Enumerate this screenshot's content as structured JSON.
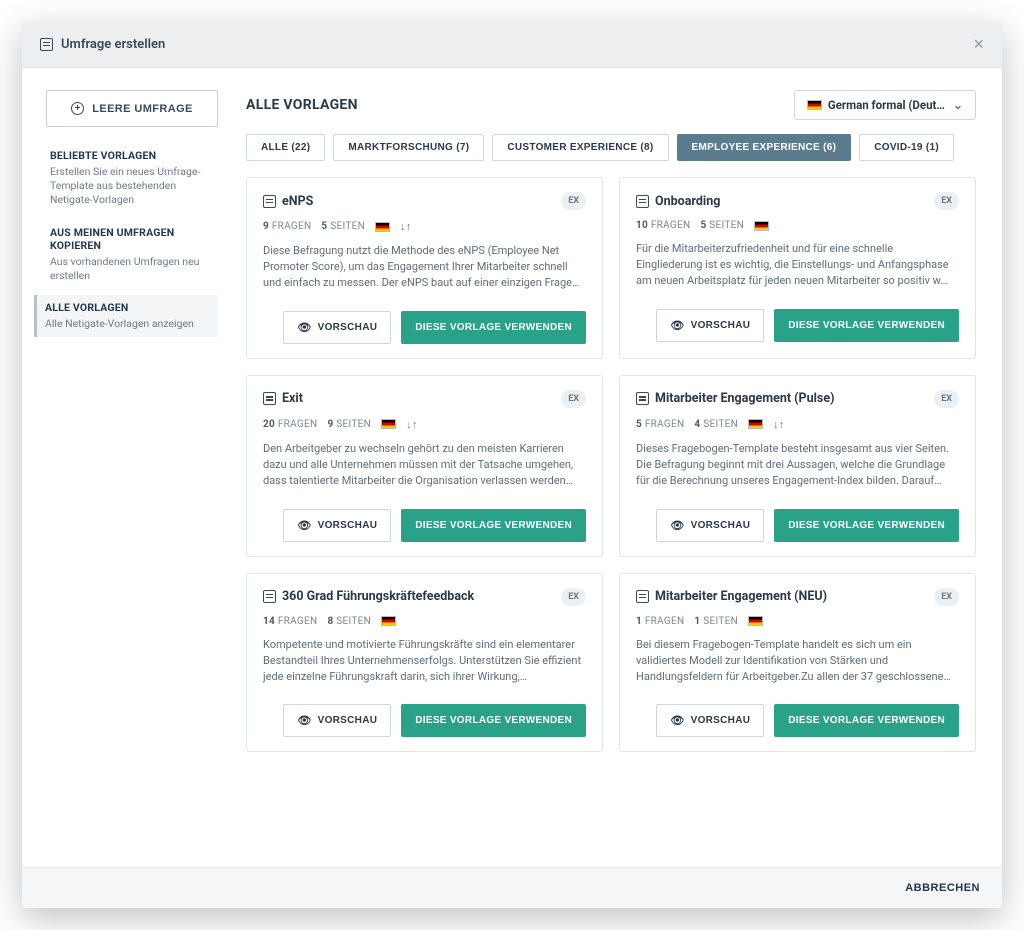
{
  "header": {
    "title": "Umfrage erstellen"
  },
  "sidebar": {
    "blank_label": "LEERE UMFRAGE",
    "items": [
      {
        "title": "BELIEBTE VORLAGEN",
        "desc": "Erstellen Sie ein neues Umfrage-Template aus bestehenden Netigate-Vorlagen",
        "active": false
      },
      {
        "title": "AUS MEINEN UMFRAGEN KOPIEREN",
        "desc": "Aus vorhandenen Umfragen neu erstellen",
        "active": false
      },
      {
        "title": "ALLE VORLAGEN",
        "desc": "Alle Netigate-Vorlagen anzeigen",
        "active": true
      }
    ]
  },
  "main": {
    "title": "ALLE VORLAGEN",
    "lang_label": "German formal (Deut…",
    "tabs": [
      {
        "label": "ALLE (22)",
        "active": false
      },
      {
        "label": "MARKTFORSCHUNG (7)",
        "active": false
      },
      {
        "label": "CUSTOMER EXPERIENCE (8)",
        "active": false
      },
      {
        "label": "EMPLOYEE EXPERIENCE (6)",
        "active": true
      },
      {
        "label": "COVID-19 (1)",
        "active": false
      }
    ],
    "labels": {
      "questions": "FRAGEN",
      "pages": "SEITEN",
      "preview": "VORSCHAU",
      "use": "DIESE VORLAGE VERWENDEN",
      "badge": "EX"
    },
    "cards": [
      {
        "title": "eNPS",
        "questions": 9,
        "pages": 5,
        "has_params": true,
        "desc": "Diese Befragung nutzt die Methode des eNPS (Employee Net Promoter Score), um das Engagement Ihrer Mitarbeiter schnell und einfach zu messen. Der eNPS baut auf einer einzigen Frage…"
      },
      {
        "title": "Onboarding",
        "questions": 10,
        "pages": 5,
        "has_params": false,
        "desc": "Für die Mitarbeiterzufriedenheit und für eine schnelle Eingliederung ist es wichtig, die Einstellungs- und Anfangsphase am neuen Arbeitsplatz für jeden neuen Mitarbeiter so positiv w…"
      },
      {
        "title": "Exit",
        "questions": 20,
        "pages": 9,
        "has_params": true,
        "desc": "Den Arbeitgeber zu wechseln gehört zu den meisten Karrieren dazu und alle Unternehmen müssen mit der Tatsache umgehen, dass talentierte Mitarbeiter die Organisation verlassen werden…"
      },
      {
        "title": "Mitarbeiter Engagement (Pulse)",
        "questions": 5,
        "pages": 4,
        "has_params": true,
        "desc": "Dieses Fragebogen-Template besteht insgesamt aus vier Seiten. Die Befragung beginnt mit drei Aussagen, welche die Grundlage für die Berechnung unseres Engagement-Index bilden. Darauf…"
      },
      {
        "title": "360 Grad Führungskräftefeedback",
        "questions": 14,
        "pages": 8,
        "has_params": false,
        "desc": "Kompetente und motivierte Führungskräfte sind ein elementarer Bestandteil Ihres Unternehmenserfolgs. Unterstützen Sie effizient jede einzelne Führungskraft darin, sich ihrer Wirkung,…"
      },
      {
        "title": "Mitarbeiter Engagement (NEU)",
        "questions": 1,
        "pages": 1,
        "has_params": false,
        "desc": "Bei diesem Fragebogen-Template handelt es sich um ein validiertes Modell zur Identifikation von Stärken und Handlungsfeldern für Arbeitgeber.Zu allen der 37 geschlossene…"
      }
    ]
  },
  "footer": {
    "cancel": "ABBRECHEN"
  }
}
